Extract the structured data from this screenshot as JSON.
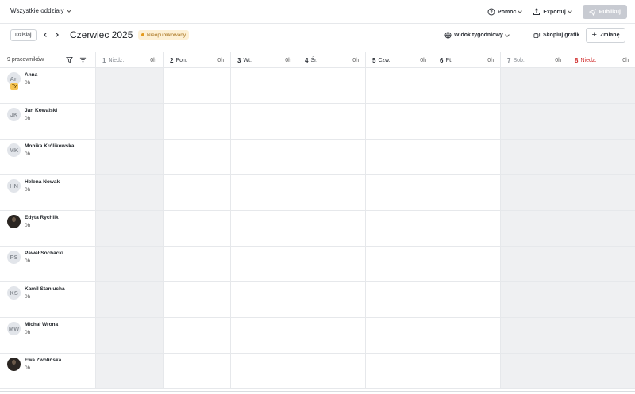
{
  "topbar": {
    "department": "Wszystkie oddziały",
    "help": "Pomoc",
    "export": "Exportuj",
    "publish": "Publikuj"
  },
  "toolbar": {
    "today": "Dzisiaj",
    "month": "Czerwiec 2025",
    "status_badge": "Nieopublikowany",
    "view": "Widok tygodniowy",
    "copy_schedule": "Skopiuj grafik",
    "add_shift": "Zmianę"
  },
  "schedule": {
    "employee_count": "9 pracowników",
    "days": [
      {
        "num": "1",
        "name": "Niedz.",
        "hours": "0h",
        "type": "weekend"
      },
      {
        "num": "2",
        "name": "Pon.",
        "hours": "0h",
        "type": "weekday"
      },
      {
        "num": "3",
        "name": "Wt.",
        "hours": "0h",
        "type": "weekday"
      },
      {
        "num": "4",
        "name": "Śr.",
        "hours": "0h",
        "type": "weekday"
      },
      {
        "num": "5",
        "name": "Czw.",
        "hours": "0h",
        "type": "weekday"
      },
      {
        "num": "6",
        "name": "Pt.",
        "hours": "0h",
        "type": "weekday"
      },
      {
        "num": "7",
        "name": "Sob.",
        "hours": "0h",
        "type": "weekend"
      },
      {
        "num": "8",
        "name": "Niedz.",
        "hours": "0h",
        "type": "sunday-red"
      }
    ],
    "employees": [
      {
        "initials": "An",
        "name": "Anna",
        "hours": "0h",
        "you": "Ty",
        "photo": false
      },
      {
        "initials": "JK",
        "name": "Jan Kowalski",
        "hours": "0h",
        "photo": false
      },
      {
        "initials": "MK",
        "name": "Monika Królikowska",
        "hours": "0h",
        "photo": false
      },
      {
        "initials": "HN",
        "name": "Helena Nowak",
        "hours": "0h",
        "photo": false
      },
      {
        "initials": "",
        "name": "Edyta Rychlik",
        "hours": "0h",
        "photo": true
      },
      {
        "initials": "PS",
        "name": "Paweł Sochacki",
        "hours": "0h",
        "photo": false
      },
      {
        "initials": "KS",
        "name": "Kamil Staniucha",
        "hours": "0h",
        "photo": false
      },
      {
        "initials": "MW",
        "name": "Michał Wrona",
        "hours": "0h",
        "photo": false
      },
      {
        "initials": "",
        "name": "Ewa Zwolińska",
        "hours": "0h",
        "photo": true
      }
    ]
  }
}
